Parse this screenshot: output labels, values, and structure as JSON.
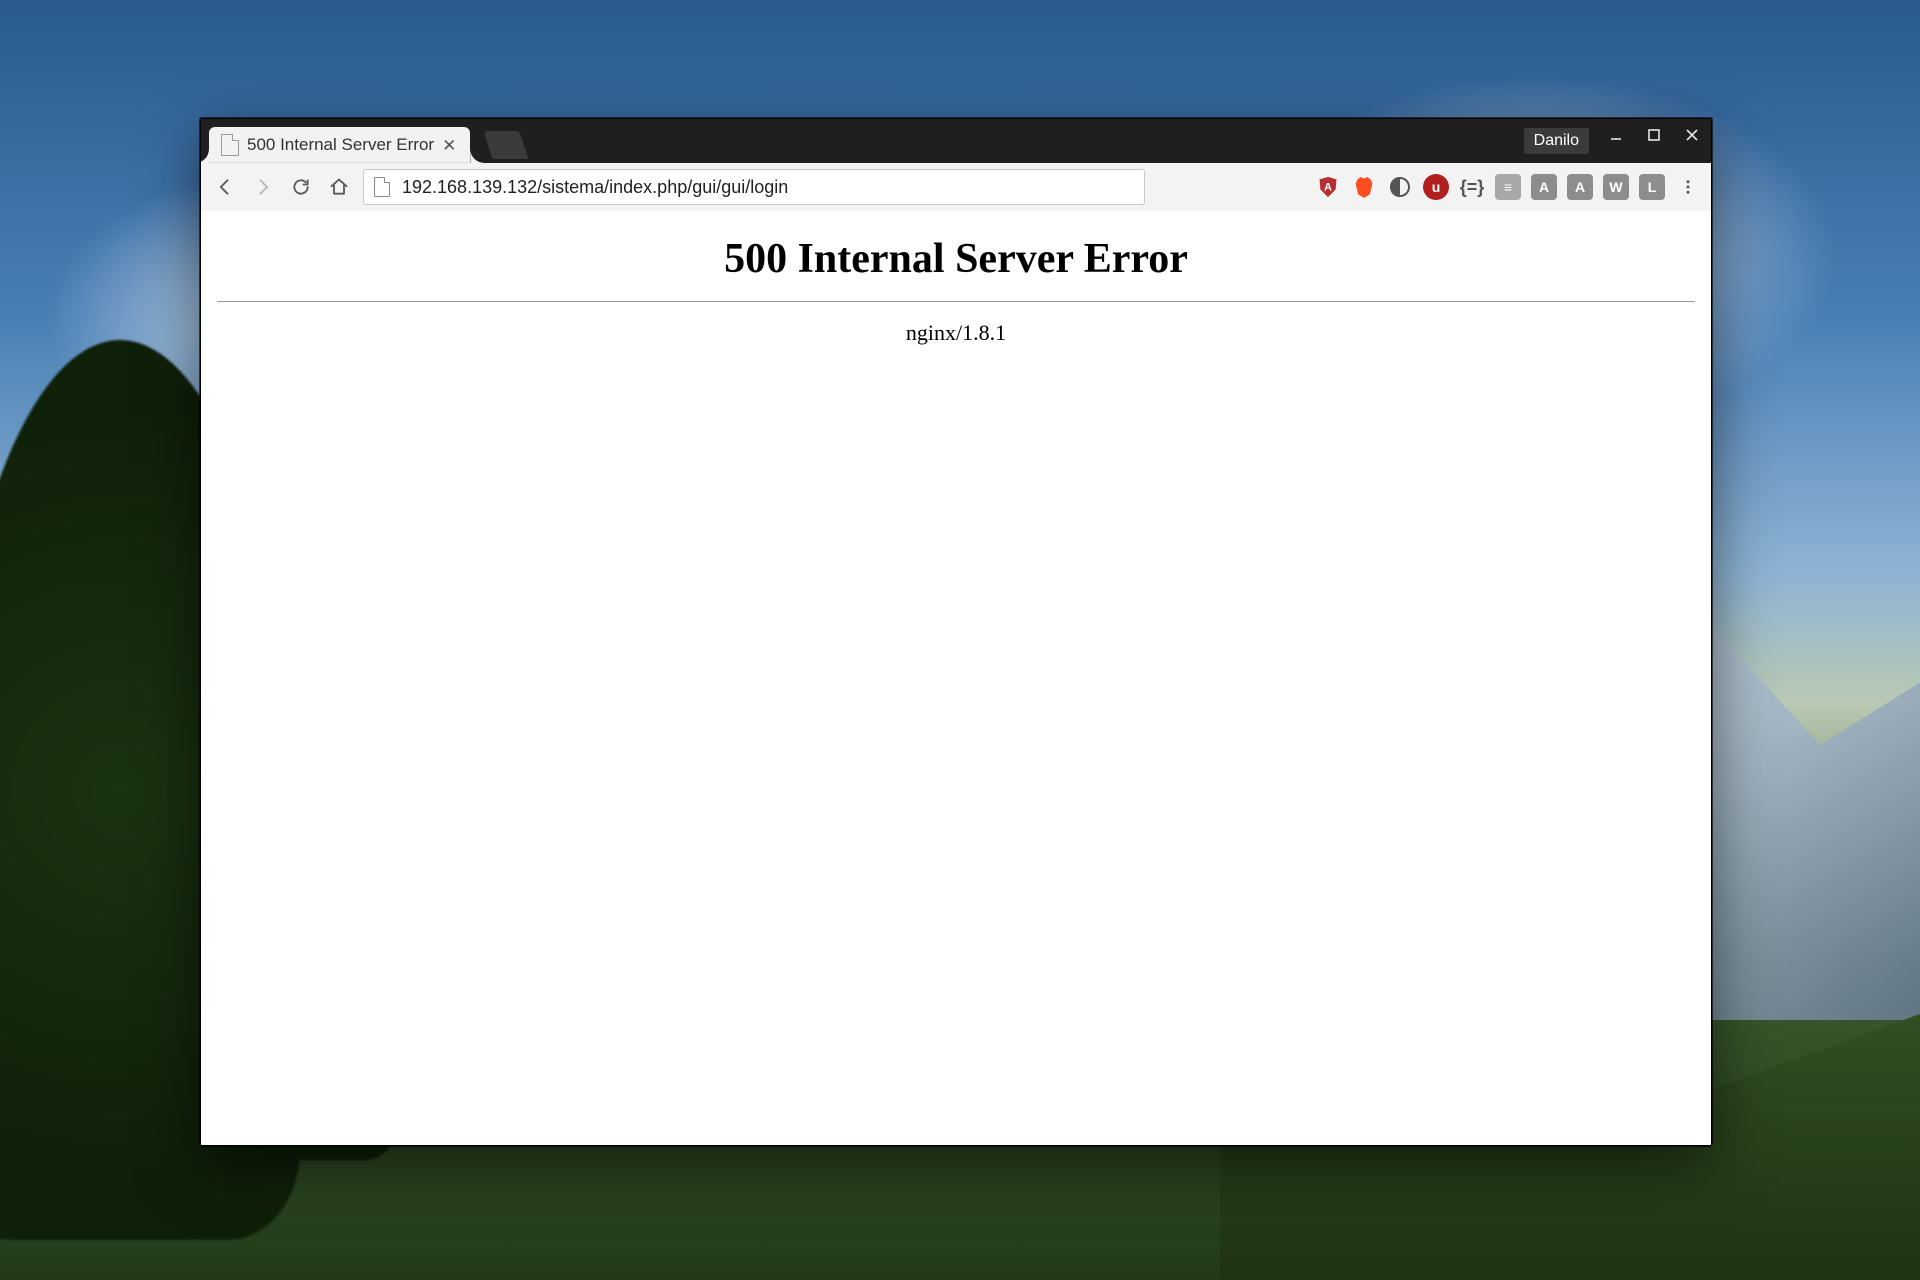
{
  "window": {
    "user_badge": "Danilo"
  },
  "tab": {
    "title": "500 Internal Server Error"
  },
  "toolbar": {
    "url": "192.168.139.132/sistema/index.php/gui/gui/login",
    "extensions": [
      {
        "name": "angular-icon",
        "glyph": "A",
        "style": "shield",
        "color": "#b52e31"
      },
      {
        "name": "brave-icon",
        "glyph": "",
        "style": "brave",
        "color": "#ff4f20"
      },
      {
        "name": "contrast-icon",
        "glyph": "",
        "style": "half",
        "color": "#555"
      },
      {
        "name": "ublock-icon",
        "glyph": "u",
        "style": "red",
        "color": "#b11f1f"
      },
      {
        "name": "braces-icon",
        "glyph": "{=}",
        "style": "code",
        "color": "#555"
      },
      {
        "name": "ext-db-icon",
        "glyph": "≡",
        "style": "gray",
        "color": "#a8a8a8"
      },
      {
        "name": "ext-a2-icon",
        "glyph": "A",
        "style": "square",
        "color": "#8d8d8d"
      },
      {
        "name": "ext-a3-icon",
        "glyph": "A",
        "style": "square",
        "color": "#8d8d8d"
      },
      {
        "name": "ext-w-icon",
        "glyph": "W",
        "style": "square",
        "color": "#8d8d8d"
      },
      {
        "name": "ext-l-icon",
        "glyph": "L",
        "style": "square",
        "color": "#8d8d8d"
      }
    ]
  },
  "page": {
    "heading": "500 Internal Server Error",
    "server_line": "nginx/1.8.1"
  }
}
